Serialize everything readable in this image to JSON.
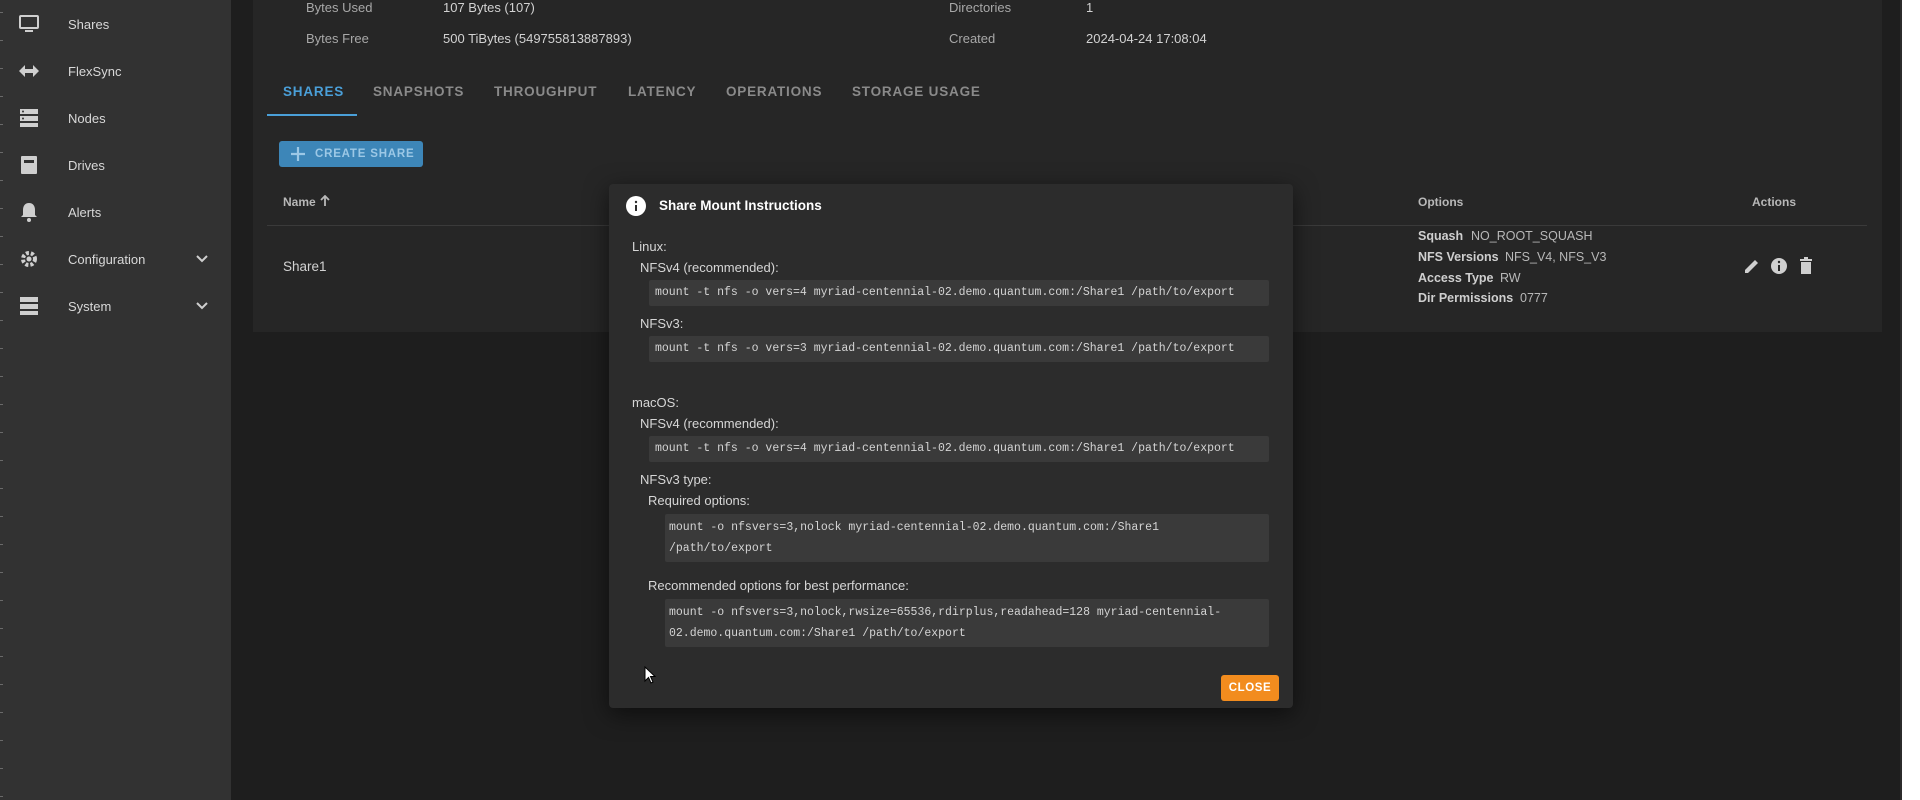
{
  "sidebar": {
    "items": [
      {
        "label": "Shares",
        "icon": "monitor-icon"
      },
      {
        "label": "FlexSync",
        "icon": "arrows-horizontal-icon"
      },
      {
        "label": "Nodes",
        "icon": "server-icon"
      },
      {
        "label": "Drives",
        "icon": "drive-icon"
      },
      {
        "label": "Alerts",
        "icon": "bell-icon"
      },
      {
        "label": "Configuration",
        "icon": "gear-icon"
      },
      {
        "label": "System",
        "icon": "stack-icon"
      }
    ]
  },
  "info": {
    "bytes_used_label": "Bytes Used",
    "bytes_used_value": "107 Bytes (107)",
    "bytes_free_label": "Bytes Free",
    "bytes_free_value": "500 TiBytes (549755813887893)",
    "directories_label": "Directories",
    "directories_value": "1",
    "created_label": "Created",
    "created_value": "2024-04-24 17:08:04"
  },
  "tabs": [
    "SHARES",
    "SNAPSHOTS",
    "THROUGHPUT",
    "LATENCY",
    "OPERATIONS",
    "STORAGE USAGE"
  ],
  "create_share_label": "CREATE SHARE",
  "table": {
    "headers": {
      "name": "Name",
      "options": "Options",
      "actions": "Actions"
    },
    "rows": [
      {
        "name": "Share1",
        "options": [
          {
            "label": "Squash",
            "value": "NO_ROOT_SQUASH"
          },
          {
            "label": "NFS Versions",
            "value": "NFS_V4, NFS_V3"
          },
          {
            "label": "Access Type",
            "value": "RW"
          },
          {
            "label": "Dir Permissions",
            "value": "0777"
          }
        ]
      }
    ]
  },
  "modal": {
    "title": "Share Mount Instructions",
    "linux_label": "Linux:",
    "linux_nfsv4_label": "NFSv4 (recommended):",
    "linux_nfsv4_cmd": "mount -t nfs -o vers=4 myriad-centennial-02.demo.quantum.com:/Share1 /path/to/export",
    "linux_nfsv3_label": "NFSv3:",
    "linux_nfsv3_cmd": "mount -t nfs -o vers=3 myriad-centennial-02.demo.quantum.com:/Share1 /path/to/export",
    "macos_label": "macOS:",
    "macos_nfsv4_label": "NFSv4 (recommended):",
    "macos_nfsv4_cmd": "mount -t nfs -o vers=4 myriad-centennial-02.demo.quantum.com:/Share1 /path/to/export",
    "macos_nfsv3_label": "NFSv3 type:",
    "required_label": "Required options:",
    "required_cmd": "mount -o nfsvers=3,nolock myriad-centennial-02.demo.quantum.com:/Share1 /path/to/export",
    "recommended_label": "Recommended options for best performance:",
    "recommended_cmd": "mount -o nfsvers=3,nolock,rwsize=65536,rdirplus,readahead=128 myriad-centennial-02.demo.quantum.com:/Share1 /path/to/export",
    "close_label": "CLOSE"
  },
  "colors": {
    "accent": "#4a9fd8",
    "close_button": "#f28c1e",
    "sidebar_bg": "#323232",
    "panel_bg": "#262626"
  }
}
